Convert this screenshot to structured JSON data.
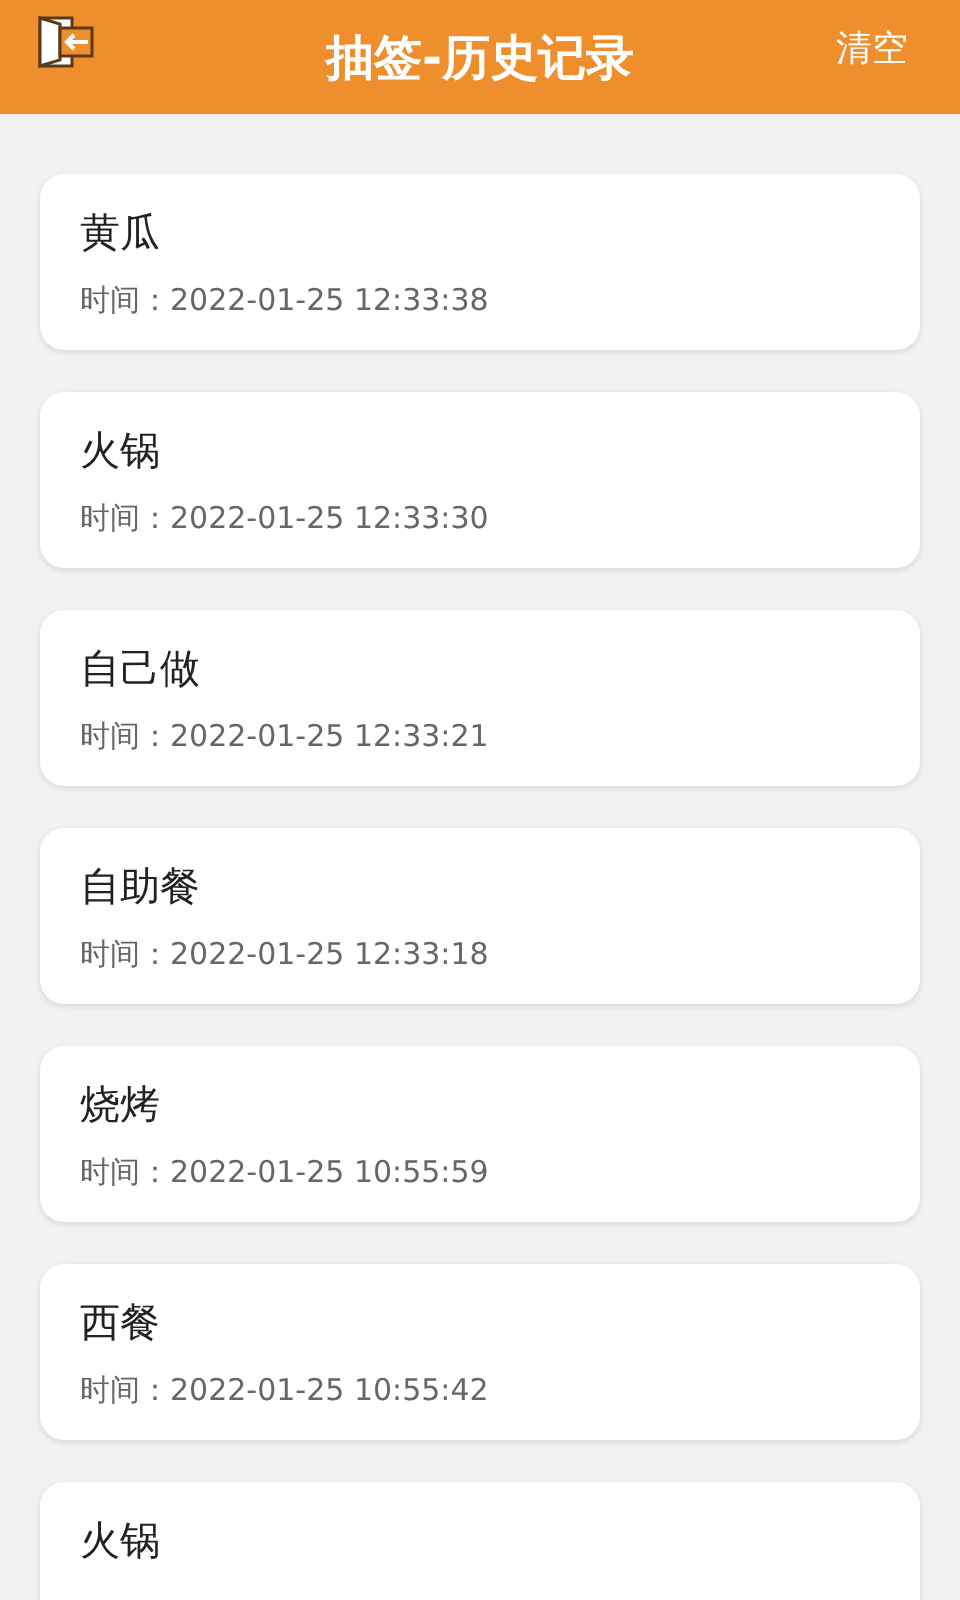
{
  "header": {
    "title": "抽签-历史记录",
    "action": "清空"
  },
  "records": [
    {
      "name": "黄瓜",
      "time": "时间：2022-01-25 12:33:38"
    },
    {
      "name": "火锅",
      "time": "时间：2022-01-25 12:33:30"
    },
    {
      "name": "自己做",
      "time": "时间：2022-01-25 12:33:21"
    },
    {
      "name": "自助餐",
      "time": "时间：2022-01-25 12:33:18"
    },
    {
      "name": "烧烤",
      "time": "时间：2022-01-25 10:55:59"
    },
    {
      "name": "西餐",
      "time": "时间：2022-01-25 10:55:42"
    },
    {
      "name": "火锅"
    }
  ]
}
